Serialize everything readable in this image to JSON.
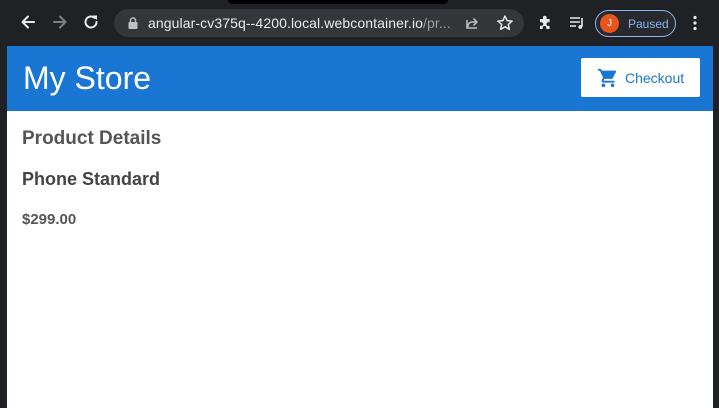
{
  "browser": {
    "url_host": "angular-cv375q--4200.local.webcontainer.io",
    "url_path": "/pr...",
    "profile_initial": "J",
    "profile_status": "Paused",
    "colors": {
      "chrome": "#202124",
      "omnibox": "#35363a",
      "profile_accent": "#8ab4f8",
      "avatar": "#e8531e"
    }
  },
  "header": {
    "title": "My Store",
    "checkout_label": "Checkout",
    "colors": {
      "bar": "#1976d2"
    }
  },
  "main": {
    "heading": "Product Details",
    "product_name": "Phone Standard",
    "product_price": "$299.00"
  }
}
